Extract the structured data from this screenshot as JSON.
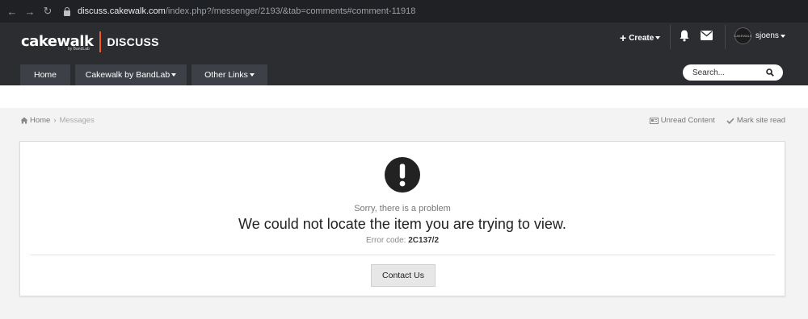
{
  "browser": {
    "back_icon": "←",
    "forward_icon": "→",
    "reload_icon": "↻",
    "url_domain": "discuss.cakewalk.com",
    "url_path": "/index.php?/messenger/2193/&tab=comments#comment-11918"
  },
  "header": {
    "logo_word": "cakewalk",
    "logo_sub": "by BandLab",
    "logo_section": "DISCUSS",
    "create_label": "Create",
    "username": "sjoens",
    "avatar_text": "CAKEWALK",
    "accent_color": "#f25a1e"
  },
  "nav": {
    "tabs": [
      {
        "label": "Home"
      },
      {
        "label": "Cakewalk by BandLab"
      },
      {
        "label": "Other Links"
      }
    ],
    "search_placeholder": "Search..."
  },
  "breadcrumb": {
    "home": "Home",
    "sep": "›",
    "current": "Messages"
  },
  "actions": {
    "unread": "Unread Content",
    "mark_read": "Mark site read"
  },
  "error": {
    "sorry": "Sorry, there is a problem",
    "message": "We could not locate the item you are trying to view.",
    "code_label": "Error code:",
    "code": "2C137/2",
    "contact_button": "Contact Us"
  }
}
